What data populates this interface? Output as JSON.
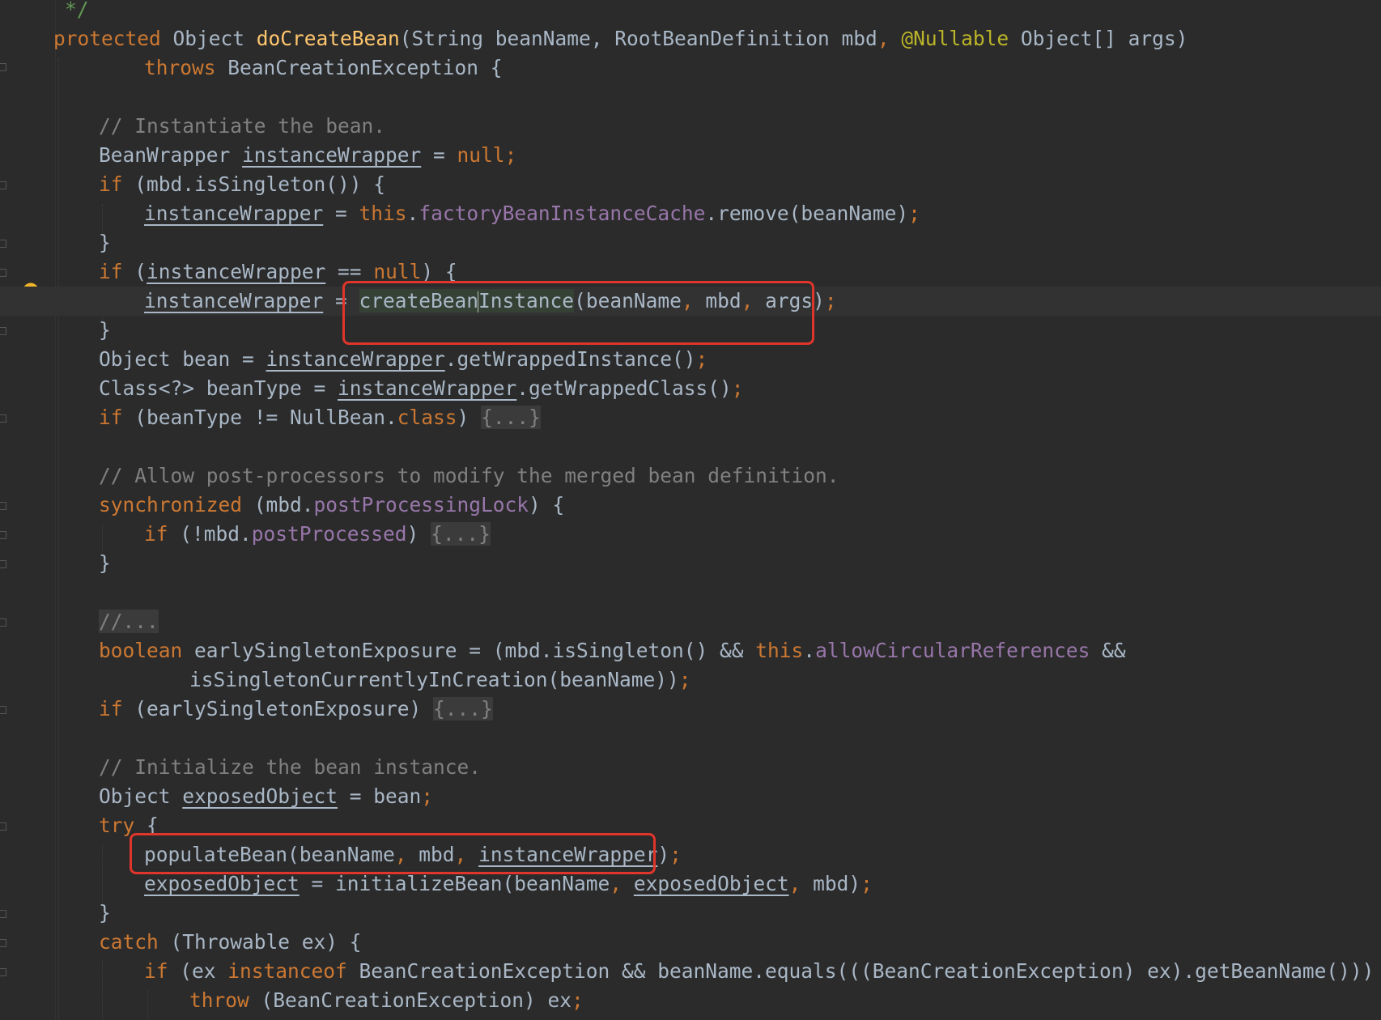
{
  "colors": {
    "background": "#2b2b2b",
    "keyword": "#cc7832",
    "method_declaration": "#ffc66d",
    "field": "#9876aa",
    "comment": "#808080",
    "annotation": "#bbb529",
    "default_text": "#a9b7c6",
    "highlight_box": "#e0352b"
  },
  "icons": {
    "intention_bulb": "lightbulb-icon"
  },
  "lines": {
    "l00": {
      "c1": "*/"
    },
    "l01": {
      "k1": "protected",
      "t1": " Object ",
      "fn": "doCreateBean",
      "t2": "(String beanName, RootBeanDefinition mbd",
      "p1": ",",
      "sp1": " ",
      "ann": "@Nullable",
      "t3": " Object[] args)"
    },
    "l02": {
      "k1": "throws",
      "t1": " BeanCreationException {"
    },
    "l04": {
      "c1": "// Instantiate the bean."
    },
    "l05": {
      "t1": "BeanWrapper ",
      "v1": "instanceWrapper",
      "t2": " = ",
      "k1": "null",
      "p1": ";"
    },
    "l06": {
      "k1": "if",
      "t1": " (mbd.isSingleton()) {"
    },
    "l07": {
      "v1": "instanceWrapper",
      "t1": " = ",
      "k1": "this",
      "t2": ".",
      "f1": "factoryBeanInstanceCache",
      "t3": ".remove(beanName)",
      "p1": ";"
    },
    "l08": {
      "t1": "}"
    },
    "l09": {
      "k1": "if",
      "t1": " (",
      "v1": "instanceWrapper",
      "t2": " == ",
      "k2": "null",
      "t3": ") {"
    },
    "l10": {
      "v1": "instanceWrapper",
      "t1": " = ",
      "m1": "createBean",
      "m2": "Instance",
      "t2": "(beanName",
      "p1": ",",
      "t3": " mbd",
      "p2": ",",
      "t4": " args)",
      "p3": ";"
    },
    "l11": {
      "t1": "}"
    },
    "l12": {
      "t1": "Object bean = ",
      "v1": "instanceWrapper",
      "t2": ".getWrappedInstance()",
      "p1": ";"
    },
    "l13": {
      "t1": "Class<?> beanType = ",
      "v1": "instanceWrapper",
      "t2": ".getWrappedClass()",
      "p1": ";"
    },
    "l14": {
      "k1": "if",
      "t1": " (beanType != NullBean.",
      "k2": "class",
      "t2": ") ",
      "fb": "{...}"
    },
    "l16": {
      "c1": "// Allow post-processors to modify the merged bean definition."
    },
    "l17": {
      "k1": "synchronized",
      "t1": " (mbd.",
      "f1": "postProcessingLock",
      "t2": ") {"
    },
    "l18": {
      "k1": "if",
      "t1": " (!mbd.",
      "f1": "postProcessed",
      "t2": ") ",
      "fb": "{...}"
    },
    "l19": {
      "t1": "}"
    },
    "l21": {
      "fb": "//..."
    },
    "l22": {
      "k1": "boolean",
      "t1": " earlySingletonExposure = (mbd.isSingleton() && ",
      "k2": "this",
      "t2": ".",
      "f1": "allowCircularReferences",
      "t3": " &&"
    },
    "l23": {
      "t1": "isSingletonCurrentlyInCreation(beanName))",
      "p1": ";"
    },
    "l24": {
      "k1": "if",
      "t1": " (earlySingletonExposure) ",
      "fb": "{...}"
    },
    "l26": {
      "c1": "// Initialize the bean instance."
    },
    "l27": {
      "t1": "Object ",
      "v1": "exposedObject",
      "t2": " = bean",
      "p1": ";"
    },
    "l28": {
      "k1": "try",
      "t1": " {"
    },
    "l29": {
      "t1": "populateBean(beanName",
      "p1": ",",
      "t2": " mbd",
      "p2": ",",
      "sp": " ",
      "v1": "instanceWrapper",
      "t3": ")",
      "p3": ";"
    },
    "l30": {
      "v1": "exposedObject",
      "t1": " = initializeBean(beanName",
      "p1": ",",
      "sp": " ",
      "v2": "exposedObject",
      "p2": ",",
      "t2": " mbd)",
      "p3": ";"
    },
    "l31": {
      "t1": "}"
    },
    "l32": {
      "k1": "catch",
      "t1": " (Throwable ex) {"
    },
    "l33": {
      "k1": "if",
      "t1": " (ex ",
      "k2": "instanceof",
      "t2": " BeanCreationException && beanName.equals(((BeanCreationException) ex).getBeanName())) {"
    },
    "l34": {
      "k1": "throw",
      "t1": " (BeanCreationException) ex",
      "p1": ";"
    }
  }
}
